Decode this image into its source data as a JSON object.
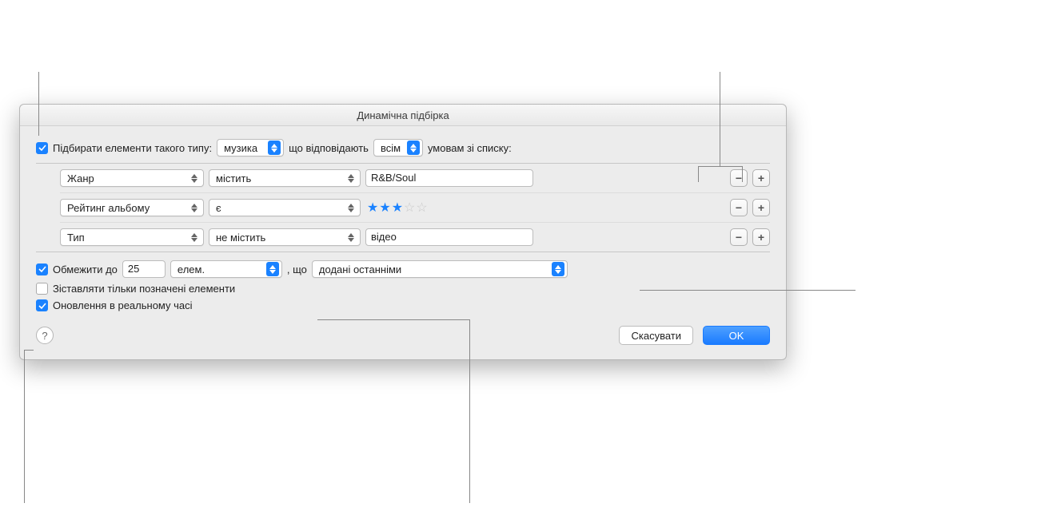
{
  "title": "Динамічна підбірка",
  "matchRow": {
    "prefix": "Підбирати елементи такого типу:",
    "typeValue": "музика",
    "middle": "що відповідають",
    "scopeValue": "всім",
    "suffix": "умовам зі списку:"
  },
  "rules": [
    {
      "field": "Жанр",
      "op": "містить",
      "value": "R&B/Soul",
      "kind": "text"
    },
    {
      "field": "Рейтинг альбому",
      "op": "є",
      "value": 3,
      "kind": "stars"
    },
    {
      "field": "Тип",
      "op": "не містить",
      "value": "відео",
      "kind": "text"
    }
  ],
  "limit": {
    "label": "Обмежити до",
    "count": "25",
    "unit": "елем.",
    "joiner": ", що",
    "criteria": "додані останніми"
  },
  "matchOnlyChecked": {
    "label": "Зіставляти тільки позначені елементи",
    "checked": false
  },
  "liveUpdate": {
    "label": "Оновлення в реальному часі",
    "checked": true
  },
  "buttons": {
    "cancel": "Скасувати",
    "ok": "OK"
  },
  "icons": {
    "minus": "−",
    "plus": "+",
    "help": "?"
  }
}
